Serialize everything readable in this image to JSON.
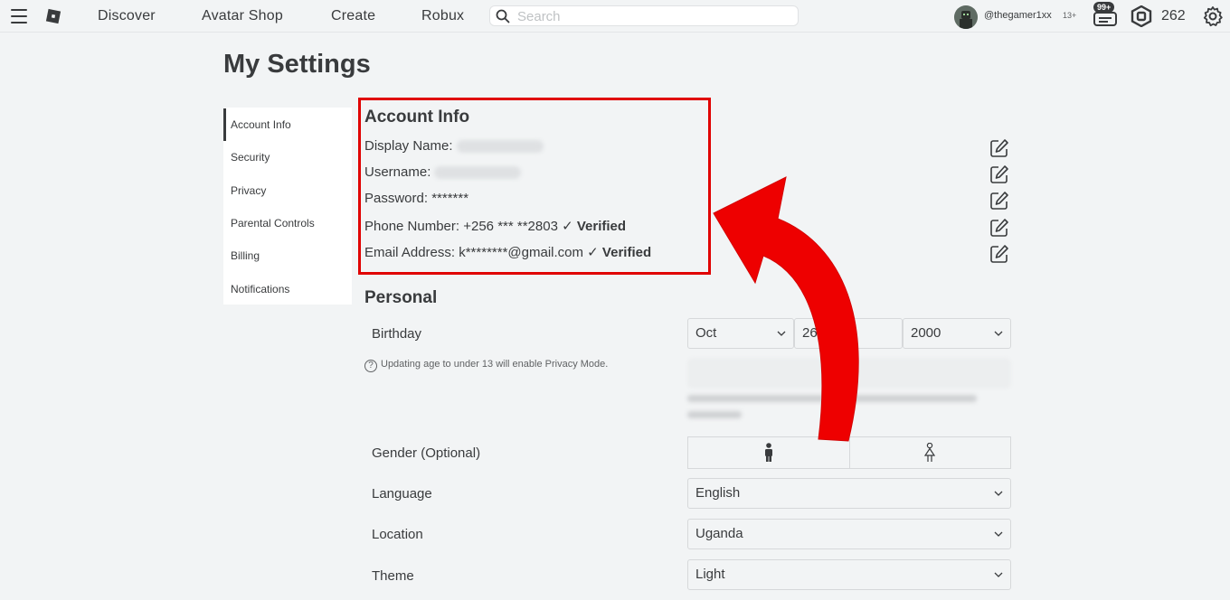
{
  "nav": {
    "links": [
      "Discover",
      "Avatar Shop",
      "Create",
      "Robux"
    ],
    "search_placeholder": "Search",
    "username": "@thegamer1xx",
    "age_tag": "13+",
    "notifications_badge": "99+",
    "robux_count": "262"
  },
  "page": {
    "title": "My Settings"
  },
  "sidebar": {
    "items": [
      {
        "label": "Account Info"
      },
      {
        "label": "Security"
      },
      {
        "label": "Privacy"
      },
      {
        "label": "Parental Controls"
      },
      {
        "label": "Billing"
      },
      {
        "label": "Notifications"
      }
    ]
  },
  "account_info": {
    "title": "Account Info",
    "display_name_label": "Display Name:",
    "username_label": "Username:",
    "password_label": "Password:",
    "password_value": "*******",
    "phone_label": "Phone Number:",
    "phone_value": "+256 *** **2803",
    "email_label": "Email Address:",
    "email_value": "k********@gmail.com",
    "verified_label": "Verified",
    "check_glyph": "✓"
  },
  "personal": {
    "title": "Personal",
    "birthday_label": "Birthday",
    "birth_month": "Oct",
    "birth_day": "26",
    "birth_year": "2000",
    "age_hint": "Updating age to under 13 will enable Privacy Mode.",
    "gender_label": "Gender (Optional)",
    "language_label": "Language",
    "language_value": "English",
    "location_label": "Location",
    "location_value": "Uganda",
    "theme_label": "Theme",
    "theme_value": "Light"
  },
  "colors": {
    "highlight": "#e00000",
    "arrow": "#ee0000",
    "background": "#f2f4f5",
    "text": "#393b3d"
  }
}
